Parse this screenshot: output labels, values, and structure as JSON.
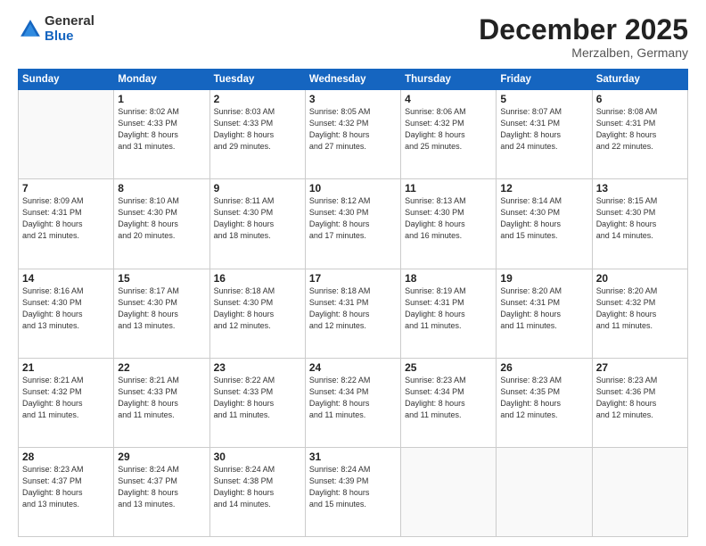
{
  "logo": {
    "general": "General",
    "blue": "Blue"
  },
  "header": {
    "month": "December 2025",
    "location": "Merzalben, Germany"
  },
  "weekdays": [
    "Sunday",
    "Monday",
    "Tuesday",
    "Wednesday",
    "Thursday",
    "Friday",
    "Saturday"
  ],
  "weeks": [
    [
      {
        "day": "",
        "sunrise": "",
        "sunset": "",
        "daylight": ""
      },
      {
        "day": "1",
        "sunrise": "Sunrise: 8:02 AM",
        "sunset": "Sunset: 4:33 PM",
        "daylight": "Daylight: 8 hours and 31 minutes."
      },
      {
        "day": "2",
        "sunrise": "Sunrise: 8:03 AM",
        "sunset": "Sunset: 4:33 PM",
        "daylight": "Daylight: 8 hours and 29 minutes."
      },
      {
        "day": "3",
        "sunrise": "Sunrise: 8:05 AM",
        "sunset": "Sunset: 4:32 PM",
        "daylight": "Daylight: 8 hours and 27 minutes."
      },
      {
        "day": "4",
        "sunrise": "Sunrise: 8:06 AM",
        "sunset": "Sunset: 4:32 PM",
        "daylight": "Daylight: 8 hours and 25 minutes."
      },
      {
        "day": "5",
        "sunrise": "Sunrise: 8:07 AM",
        "sunset": "Sunset: 4:31 PM",
        "daylight": "Daylight: 8 hours and 24 minutes."
      },
      {
        "day": "6",
        "sunrise": "Sunrise: 8:08 AM",
        "sunset": "Sunset: 4:31 PM",
        "daylight": "Daylight: 8 hours and 22 minutes."
      }
    ],
    [
      {
        "day": "7",
        "sunrise": "Sunrise: 8:09 AM",
        "sunset": "Sunset: 4:31 PM",
        "daylight": "Daylight: 8 hours and 21 minutes."
      },
      {
        "day": "8",
        "sunrise": "Sunrise: 8:10 AM",
        "sunset": "Sunset: 4:30 PM",
        "daylight": "Daylight: 8 hours and 20 minutes."
      },
      {
        "day": "9",
        "sunrise": "Sunrise: 8:11 AM",
        "sunset": "Sunset: 4:30 PM",
        "daylight": "Daylight: 8 hours and 18 minutes."
      },
      {
        "day": "10",
        "sunrise": "Sunrise: 8:12 AM",
        "sunset": "Sunset: 4:30 PM",
        "daylight": "Daylight: 8 hours and 17 minutes."
      },
      {
        "day": "11",
        "sunrise": "Sunrise: 8:13 AM",
        "sunset": "Sunset: 4:30 PM",
        "daylight": "Daylight: 8 hours and 16 minutes."
      },
      {
        "day": "12",
        "sunrise": "Sunrise: 8:14 AM",
        "sunset": "Sunset: 4:30 PM",
        "daylight": "Daylight: 8 hours and 15 minutes."
      },
      {
        "day": "13",
        "sunrise": "Sunrise: 8:15 AM",
        "sunset": "Sunset: 4:30 PM",
        "daylight": "Daylight: 8 hours and 14 minutes."
      }
    ],
    [
      {
        "day": "14",
        "sunrise": "Sunrise: 8:16 AM",
        "sunset": "Sunset: 4:30 PM",
        "daylight": "Daylight: 8 hours and 13 minutes."
      },
      {
        "day": "15",
        "sunrise": "Sunrise: 8:17 AM",
        "sunset": "Sunset: 4:30 PM",
        "daylight": "Daylight: 8 hours and 13 minutes."
      },
      {
        "day": "16",
        "sunrise": "Sunrise: 8:18 AM",
        "sunset": "Sunset: 4:30 PM",
        "daylight": "Daylight: 8 hours and 12 minutes."
      },
      {
        "day": "17",
        "sunrise": "Sunrise: 8:18 AM",
        "sunset": "Sunset: 4:31 PM",
        "daylight": "Daylight: 8 hours and 12 minutes."
      },
      {
        "day": "18",
        "sunrise": "Sunrise: 8:19 AM",
        "sunset": "Sunset: 4:31 PM",
        "daylight": "Daylight: 8 hours and 11 minutes."
      },
      {
        "day": "19",
        "sunrise": "Sunrise: 8:20 AM",
        "sunset": "Sunset: 4:31 PM",
        "daylight": "Daylight: 8 hours and 11 minutes."
      },
      {
        "day": "20",
        "sunrise": "Sunrise: 8:20 AM",
        "sunset": "Sunset: 4:32 PM",
        "daylight": "Daylight: 8 hours and 11 minutes."
      }
    ],
    [
      {
        "day": "21",
        "sunrise": "Sunrise: 8:21 AM",
        "sunset": "Sunset: 4:32 PM",
        "daylight": "Daylight: 8 hours and 11 minutes."
      },
      {
        "day": "22",
        "sunrise": "Sunrise: 8:21 AM",
        "sunset": "Sunset: 4:33 PM",
        "daylight": "Daylight: 8 hours and 11 minutes."
      },
      {
        "day": "23",
        "sunrise": "Sunrise: 8:22 AM",
        "sunset": "Sunset: 4:33 PM",
        "daylight": "Daylight: 8 hours and 11 minutes."
      },
      {
        "day": "24",
        "sunrise": "Sunrise: 8:22 AM",
        "sunset": "Sunset: 4:34 PM",
        "daylight": "Daylight: 8 hours and 11 minutes."
      },
      {
        "day": "25",
        "sunrise": "Sunrise: 8:23 AM",
        "sunset": "Sunset: 4:34 PM",
        "daylight": "Daylight: 8 hours and 11 minutes."
      },
      {
        "day": "26",
        "sunrise": "Sunrise: 8:23 AM",
        "sunset": "Sunset: 4:35 PM",
        "daylight": "Daylight: 8 hours and 12 minutes."
      },
      {
        "day": "27",
        "sunrise": "Sunrise: 8:23 AM",
        "sunset": "Sunset: 4:36 PM",
        "daylight": "Daylight: 8 hours and 12 minutes."
      }
    ],
    [
      {
        "day": "28",
        "sunrise": "Sunrise: 8:23 AM",
        "sunset": "Sunset: 4:37 PM",
        "daylight": "Daylight: 8 hours and 13 minutes."
      },
      {
        "day": "29",
        "sunrise": "Sunrise: 8:24 AM",
        "sunset": "Sunset: 4:37 PM",
        "daylight": "Daylight: 8 hours and 13 minutes."
      },
      {
        "day": "30",
        "sunrise": "Sunrise: 8:24 AM",
        "sunset": "Sunset: 4:38 PM",
        "daylight": "Daylight: 8 hours and 14 minutes."
      },
      {
        "day": "31",
        "sunrise": "Sunrise: 8:24 AM",
        "sunset": "Sunset: 4:39 PM",
        "daylight": "Daylight: 8 hours and 15 minutes."
      },
      {
        "day": "",
        "sunrise": "",
        "sunset": "",
        "daylight": ""
      },
      {
        "day": "",
        "sunrise": "",
        "sunset": "",
        "daylight": ""
      },
      {
        "day": "",
        "sunrise": "",
        "sunset": "",
        "daylight": ""
      }
    ]
  ]
}
